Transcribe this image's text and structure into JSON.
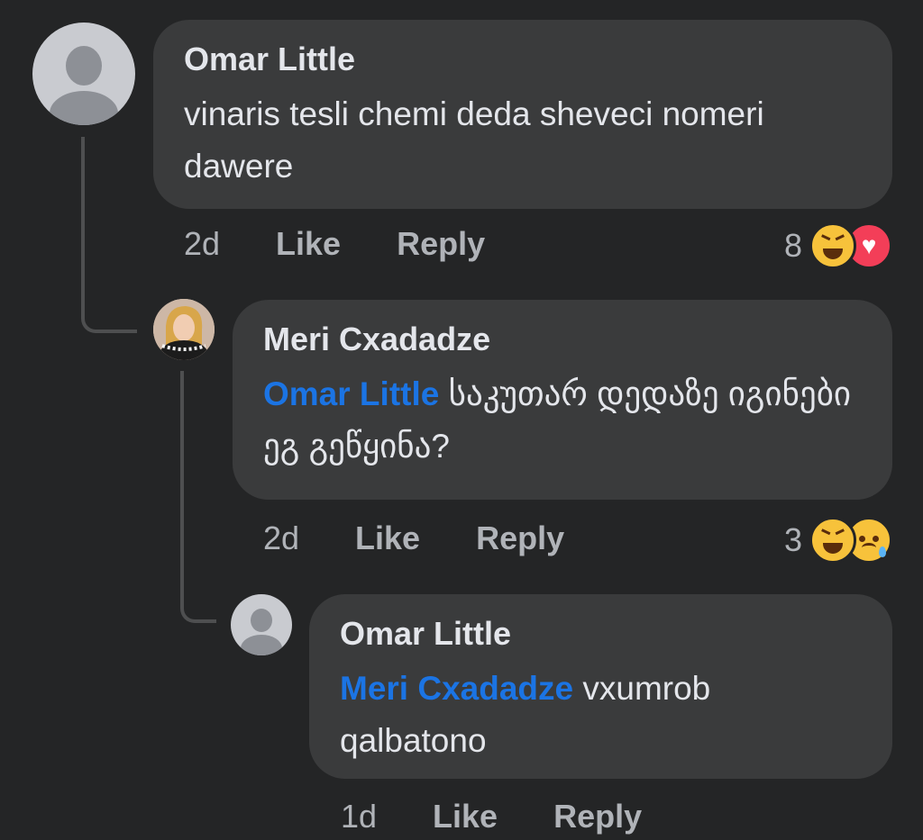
{
  "comments": [
    {
      "author": "Omar Little",
      "mention": "",
      "text": "vinaris tesli chemi deda sheveci nomeri dawere",
      "time": "2d",
      "like_label": "Like",
      "reply_label": "Reply",
      "reaction_count": "8",
      "reactions": [
        "haha-icon",
        "love-icon"
      ]
    },
    {
      "author": "Meri Cxadadze",
      "mention": "Omar Little",
      "text": "საკუთარ დედაზე იგინები ეგ გეწყინა?",
      "time": "2d",
      "like_label": "Like",
      "reply_label": "Reply",
      "reaction_count": "3",
      "reactions": [
        "haha-icon",
        "sad-icon"
      ]
    },
    {
      "author": "Omar Little",
      "mention": "Meri Cxadadze",
      "text": "vxumrob qalbatono",
      "time": "1d",
      "like_label": "Like",
      "reply_label": "Reply"
    }
  ],
  "colors": {
    "background": "#242526",
    "bubble": "#3a3b3c",
    "mention": "#1b74e4",
    "secondary_text": "#b0b3b8"
  }
}
